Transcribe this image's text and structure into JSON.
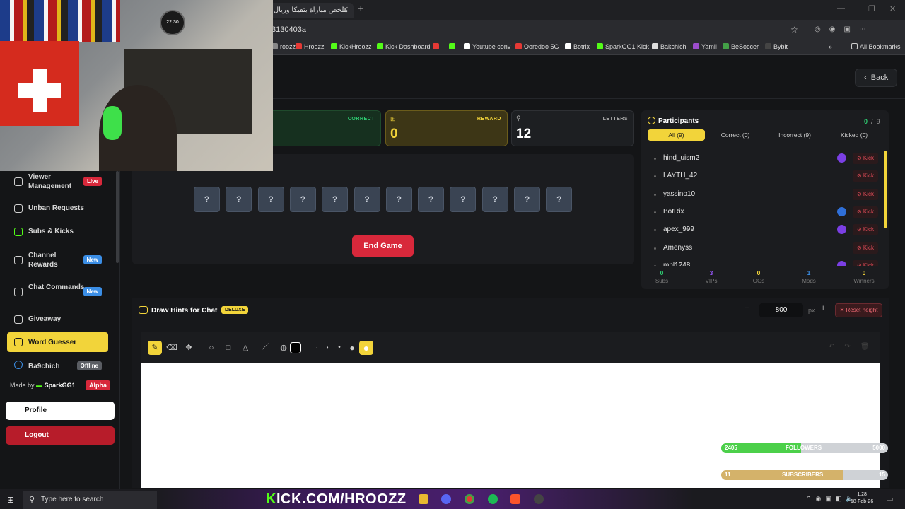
{
  "browser": {
    "tab_title": "ملخص مباراة بتفيكا وريال مـ",
    "url_fragment": "3130403a",
    "bookmarks": [
      {
        "label": "roozz",
        "color": "#888888"
      },
      {
        "label": "Hroozz",
        "color": "#e53935"
      },
      {
        "label": "KickHroozz",
        "color": "#53fc18"
      },
      {
        "label": "Kick Dashboard",
        "color": "#53fc18"
      },
      {
        "label": "",
        "color": "#e53935"
      },
      {
        "label": "",
        "color": "#53fc18"
      },
      {
        "label": "Youtube conv",
        "color": "#ffffff"
      },
      {
        "label": "Ooredoo 5G",
        "color": "#e53935"
      },
      {
        "label": "Botrix",
        "color": "#ffffff"
      },
      {
        "label": "SparkGG1 Kick",
        "color": "#53fc18"
      },
      {
        "label": "Bakchich",
        "color": "#dddddd"
      },
      {
        "label": "Yamli",
        "color": "#9c4dcc"
      },
      {
        "label": "BeSoccer",
        "color": "#43a047"
      },
      {
        "label": "Bybit",
        "color": "#444444"
      }
    ],
    "all_bookmarks": "All Bookmarks"
  },
  "header": {
    "back_label": "Back"
  },
  "sidebar": {
    "items": [
      {
        "label": "Viewer Management",
        "badge": "Live"
      },
      {
        "label": "Unban Requests",
        "badge": ""
      },
      {
        "label": "Subs & Kicks",
        "badge": ""
      },
      {
        "label": "Channel Rewards",
        "badge": "New"
      },
      {
        "label": "Chat Commands",
        "badge": "New"
      },
      {
        "label": "Giveaway",
        "badge": ""
      },
      {
        "label": "Word Guesser",
        "badge": ""
      },
      {
        "label": "Ba9chich",
        "badge": "Offline"
      }
    ],
    "made_by_prefix": "Made by",
    "made_by_name": "SparkGG1",
    "alpha_badge": "Alpha",
    "profile_label": "Profile",
    "logout_label": "Logout"
  },
  "stats": {
    "correct_label": "CORRECT",
    "reward_label": "REWARD",
    "reward_value": "0",
    "letters_label": "LETTERS",
    "letters_value": "12"
  },
  "game": {
    "letter_boxes": [
      "?",
      "?",
      "?",
      "?",
      "?",
      "?",
      "?",
      "?",
      "?",
      "?",
      "?",
      "?"
    ],
    "end_game_label": "End Game"
  },
  "participants": {
    "title": "Participants",
    "count_correct": "0",
    "count_sep": "/",
    "count_total": "9",
    "tabs": [
      "All (9)",
      "Correct (0)",
      "Incorrect (9)",
      "Kicked (0)"
    ],
    "kick_label": "Kick",
    "rows": [
      {
        "name": "hind_uism2",
        "badge": "purple"
      },
      {
        "name": "LAYTH_42",
        "badge": ""
      },
      {
        "name": "yassino10",
        "badge": ""
      },
      {
        "name": "BotRix",
        "badge": "blue"
      },
      {
        "name": "apex_999",
        "badge": "purple"
      },
      {
        "name": "Amenyss",
        "badge": ""
      },
      {
        "name": "mhl1248",
        "badge": "purple"
      }
    ],
    "stats": [
      {
        "value": "0",
        "label": "Subs",
        "color": "#2ecc71"
      },
      {
        "value": "3",
        "label": "VIPs",
        "color": "#9b59ff"
      },
      {
        "value": "0",
        "label": "OGs",
        "color": "#f2d43a"
      },
      {
        "value": "1",
        "label": "Mods",
        "color": "#3b8ee6"
      },
      {
        "value": "0",
        "label": "Winners",
        "color": "#f2d43a"
      }
    ]
  },
  "draw_hints": {
    "title": "Draw Hints for Chat",
    "badge": "DELUXE",
    "height_value": "800",
    "height_unit": "px",
    "reset_label": "Reset height",
    "tools": [
      "pencil-icon",
      "eraser-icon",
      "move-icon",
      "circle-icon",
      "square-icon",
      "triangle-icon",
      "line-icon",
      "palette-icon",
      "color-swatch",
      "size-1",
      "size-2",
      "size-3",
      "size-4",
      "size-5"
    ]
  },
  "overlay": {
    "followers": {
      "current": "2405",
      "label": "FOLLOWERS",
      "goal": "5000",
      "progress": 0.48
    },
    "subscribers": {
      "current": "11",
      "label": "SUBSCRIBERS",
      "goal": "15",
      "progress": 0.73
    },
    "cam_clock": "22:30",
    "kick_url_prefix": "K",
    "kick_url_rest": "ICK.COM/HROOZZ"
  },
  "taskbar": {
    "search_placeholder": "Type here to search",
    "time": "1:28",
    "date": "18-Feb-26"
  }
}
